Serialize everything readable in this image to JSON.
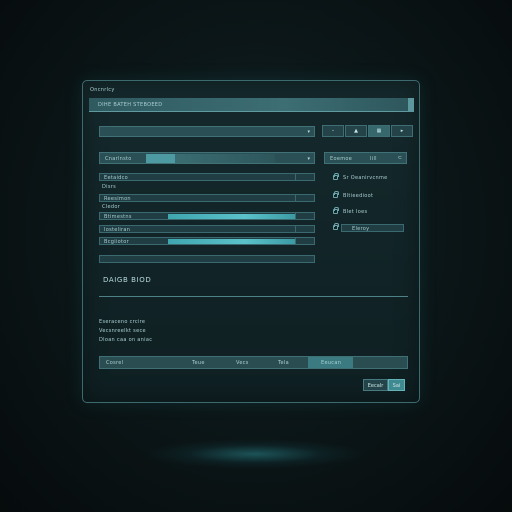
{
  "window": {
    "title": "Oncnrlcy"
  },
  "header": {
    "title": "DIHE BATEH STEBOEED"
  },
  "top_select": {
    "value": ""
  },
  "toolbar": {
    "buttons": [
      "",
      "",
      "",
      ""
    ]
  },
  "filter_select": {
    "value": "Cnarlnsto"
  },
  "side_select": {
    "label": "Eoemoe",
    "value": "Iill"
  },
  "form_rows": [
    {
      "label": "Eetaidco"
    },
    {
      "label": "Disrs",
      "standalone": true
    },
    {
      "label": "Reesimon"
    },
    {
      "label": "Cledor",
      "standalone": true
    },
    {
      "label": "Btimestns"
    },
    {
      "label": "Iosteliran"
    },
    {
      "label": "Bcgiiotor"
    },
    {
      "label": ""
    }
  ],
  "permissions": [
    {
      "label": "Sr Oeanirvcnme"
    },
    {
      "label": "Bltieedioot"
    },
    {
      "label": "Blet Ioes"
    },
    {
      "label": "Eleroy"
    }
  ],
  "section": {
    "title": "DAIGB BIOD"
  },
  "notes": [
    "Eseraceno crcire",
    "Vecsnreelkt sece",
    "Dloan caa on aniac"
  ],
  "footer": {
    "label": "Cosrel",
    "tabs": [
      "Teue",
      "Vecs",
      "Tela",
      "Eeucan"
    ],
    "active_tab": 3
  },
  "actions": {
    "secondary": "Eecalr",
    "primary": "Sai"
  },
  "colors": {
    "accent": "#3fa6b0",
    "background": "#0c1719",
    "panel": "#112326"
  }
}
